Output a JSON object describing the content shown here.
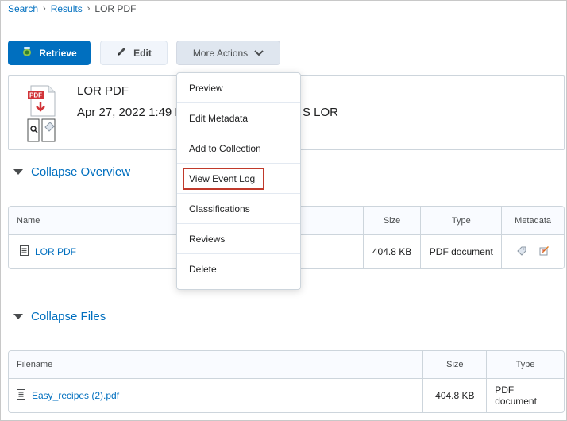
{
  "breadcrumb": {
    "items": [
      "Search",
      "Results"
    ],
    "separator": "›",
    "current": "LOR PDF"
  },
  "toolbar": {
    "retrieve_label": "Retrieve",
    "edit_label": "Edit",
    "more_label": "More Actions"
  },
  "item": {
    "title": "LOR PDF",
    "subtitle": "Apr 27, 2022 1:49 F",
    "subtitle_right": "S LOR",
    "icon_label": "PDF"
  },
  "overview": {
    "toggle_label": "Collapse Overview",
    "columns": [
      "Name",
      "Size",
      "Type",
      "Metadata"
    ],
    "rows": [
      {
        "name": "LOR PDF",
        "size": "404.8 KB",
        "type": "PDF document"
      }
    ]
  },
  "files": {
    "toggle_label": "Collapse Files",
    "columns": [
      "Filename",
      "Size",
      "Type"
    ],
    "rows": [
      {
        "name": "Easy_recipes (2).pdf",
        "size": "404.8 KB",
        "type": "PDF document"
      }
    ]
  },
  "menu": {
    "items": [
      "Preview",
      "Edit Metadata",
      "Add to Collection",
      "View Event Log",
      "Classifications",
      "Reviews",
      "Delete"
    ],
    "highlight_color": "#c0392b"
  },
  "colors": {
    "accent": "#006fbf",
    "border": "#cdd5dc"
  }
}
